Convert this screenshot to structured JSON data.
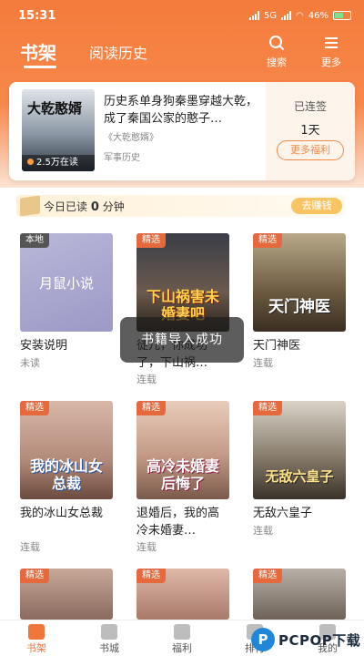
{
  "status_bar": {
    "time": "15:31",
    "network": "5G",
    "wifi": "wifi-icon",
    "battery": "46%"
  },
  "nav": {
    "tab_active": "书架",
    "tab_history": "阅读历史",
    "search_label": "搜索",
    "more_label": "更多"
  },
  "featured": {
    "cover_title": "大乾憨婿",
    "cover_reads": "2.5万在读",
    "title": "历史系单身狗秦墨穿越大乾，成了秦国公家的憨子…",
    "source": "《大乾憨婿》",
    "category": "军事历史",
    "signed_label": "已连签",
    "signed_days": "1天",
    "welfare_button": "更多福利"
  },
  "reading": {
    "prefix": "今日已读",
    "minutes": "0",
    "suffix": "分钟",
    "earn_button": "去赚钱"
  },
  "books": [
    {
      "badge": "本地",
      "cover_text": "月鼠小说",
      "title": "安装说明",
      "status": "未读"
    },
    {
      "badge": "精选",
      "cover_text": "下山祸害未婚妻吧",
      "title": "徒儿，你成功了，下山祸…",
      "status": "连载"
    },
    {
      "badge": "精选",
      "cover_text": "天门神医",
      "title": "天门神医",
      "status": "连载"
    },
    {
      "badge": "精选",
      "cover_text": "我的冰山女总裁",
      "title": "我的冰山女总裁",
      "status": "连载"
    },
    {
      "badge": "精选",
      "cover_text": "高冷未婚妻后悔了",
      "title": "退婚后，我的高冷未婚妻…",
      "status": "连载"
    },
    {
      "badge": "精选",
      "cover_text": "无敌六皇子",
      "title": "无敌六皇子",
      "status": "连载"
    },
    {
      "badge": "精选"
    },
    {
      "badge": "精选"
    },
    {
      "badge": "精选"
    }
  ],
  "toast": "书籍导入成功",
  "bottom_nav": [
    {
      "label": "书架",
      "icon": "bookshelf-icon"
    },
    {
      "label": "书城",
      "icon": "bookstore-icon"
    },
    {
      "label": "福利",
      "icon": "gift-icon"
    },
    {
      "label": "排行",
      "icon": "ranking-icon"
    },
    {
      "label": "我的",
      "icon": "profile-icon"
    }
  ],
  "watermark": {
    "logo": "P",
    "text": "PCPOP下载"
  },
  "colors": {
    "accent": "#f47c3c",
    "badge": "#e46a3d",
    "earn": "#f9c463"
  }
}
